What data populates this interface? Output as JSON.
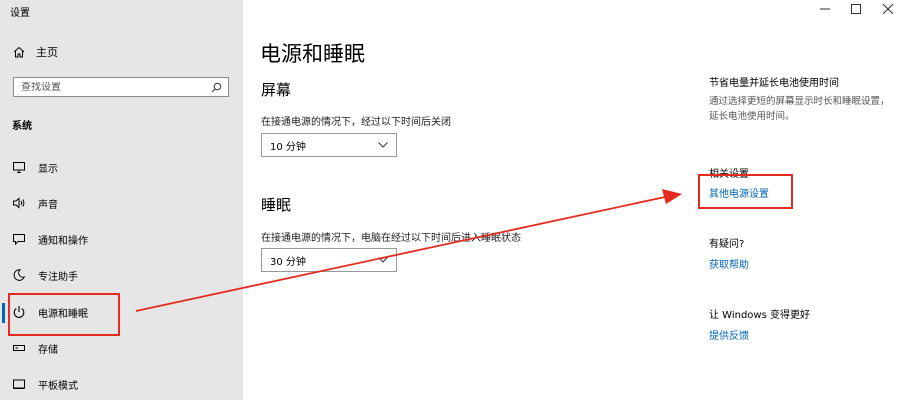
{
  "window": {
    "title": "设置",
    "controls": [
      "minimize",
      "maximize",
      "close"
    ]
  },
  "sidebar": {
    "home_label": "主页",
    "search_placeholder": "查找设置",
    "section_label": "系统",
    "items": [
      {
        "label": "显示",
        "icon": "monitor-icon"
      },
      {
        "label": "声音",
        "icon": "speaker-icon"
      },
      {
        "label": "通知和操作",
        "icon": "notification-icon"
      },
      {
        "label": "专注助手",
        "icon": "moon-icon"
      },
      {
        "label": "电源和睡眠",
        "icon": "power-icon",
        "active": true
      },
      {
        "label": "存储",
        "icon": "storage-icon"
      },
      {
        "label": "平板模式",
        "icon": "tablet-icon"
      }
    ]
  },
  "main": {
    "title": "电源和睡眠",
    "screen": {
      "heading": "屏幕",
      "description": "在接通电源的情况下，经过以下时间后关闭",
      "value": "10 分钟"
    },
    "sleep": {
      "heading": "睡眠",
      "description": "在接通电源的情况下，电脑在经过以下时间后进入睡眠状态",
      "value": "30 分钟"
    }
  },
  "right": {
    "tip_title": "节省电量并延长电池使用时间",
    "tip_desc": "通过选择更短的屏幕显示时长和睡眠设置，延长电池使用时间。",
    "related_title": "相关设置",
    "related_link": "其他电源设置",
    "help_title": "有疑问?",
    "help_link": "获取帮助",
    "feedback_title": "让 Windows 变得更好",
    "feedback_link": "提供反馈"
  },
  "annotation": {
    "color": "#e52b20"
  },
  "colors": {
    "sidebar_bg": "#e6e6e6",
    "accent": "#0067c0",
    "link": "#0066b4"
  }
}
